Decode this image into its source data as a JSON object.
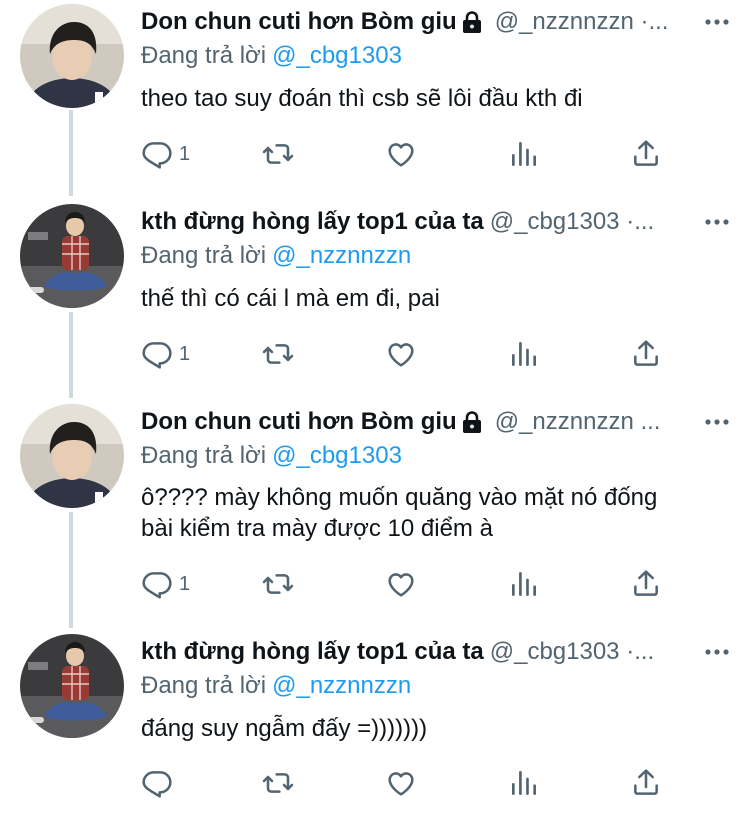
{
  "colors": {
    "link": "#1d9bf0",
    "muted": "#536471",
    "text": "#0f1419",
    "thread": "#cfd9de"
  },
  "icons": {
    "reply": "reply-icon",
    "retweet": "retweet-icon",
    "like": "heart-icon",
    "views": "analytics-icon",
    "share": "share-icon",
    "more": "more-icon",
    "lock": "lock-icon"
  },
  "tweets": [
    {
      "name": "Don chun cuti hơn Bòm giu",
      "handle": "@_nzznnzzn ·...",
      "reply_label": "Đang trả lời",
      "reply_to": "@_cbg1303",
      "lines": [
        "theo tao suy đoán thì csb sẽ lôi đầu kth đi"
      ],
      "reply_count": "1"
    },
    {
      "name": "kth đừng hòng lấy top1 của ta",
      "handle": "@_cbg1303 ·...",
      "reply_label": "Đang trả lời",
      "reply_to": "@_nzznnzzn",
      "lines": [
        "thế thì có cái l mà em đi, pai"
      ],
      "reply_count": "1"
    },
    {
      "name": "Don chun cuti hơn Bòm giu",
      "handle": "@_nzznnzzn ...",
      "reply_label": "Đang trả lời",
      "reply_to": "@_cbg1303",
      "lines": [
        "ô???? mày không muốn quăng vào mặt nó đống",
        "bài kiểm tra mày được 10 điểm à"
      ],
      "reply_count": "1"
    },
    {
      "name": "kth đừng hòng lấy top1 của ta",
      "handle": "@_cbg1303 ·...",
      "reply_label": "Đang trả lời",
      "reply_to": "@_nzznnzzn",
      "lines": [
        "đáng suy ngẫm đấy =)))))))"
      ],
      "reply_count": ""
    }
  ]
}
